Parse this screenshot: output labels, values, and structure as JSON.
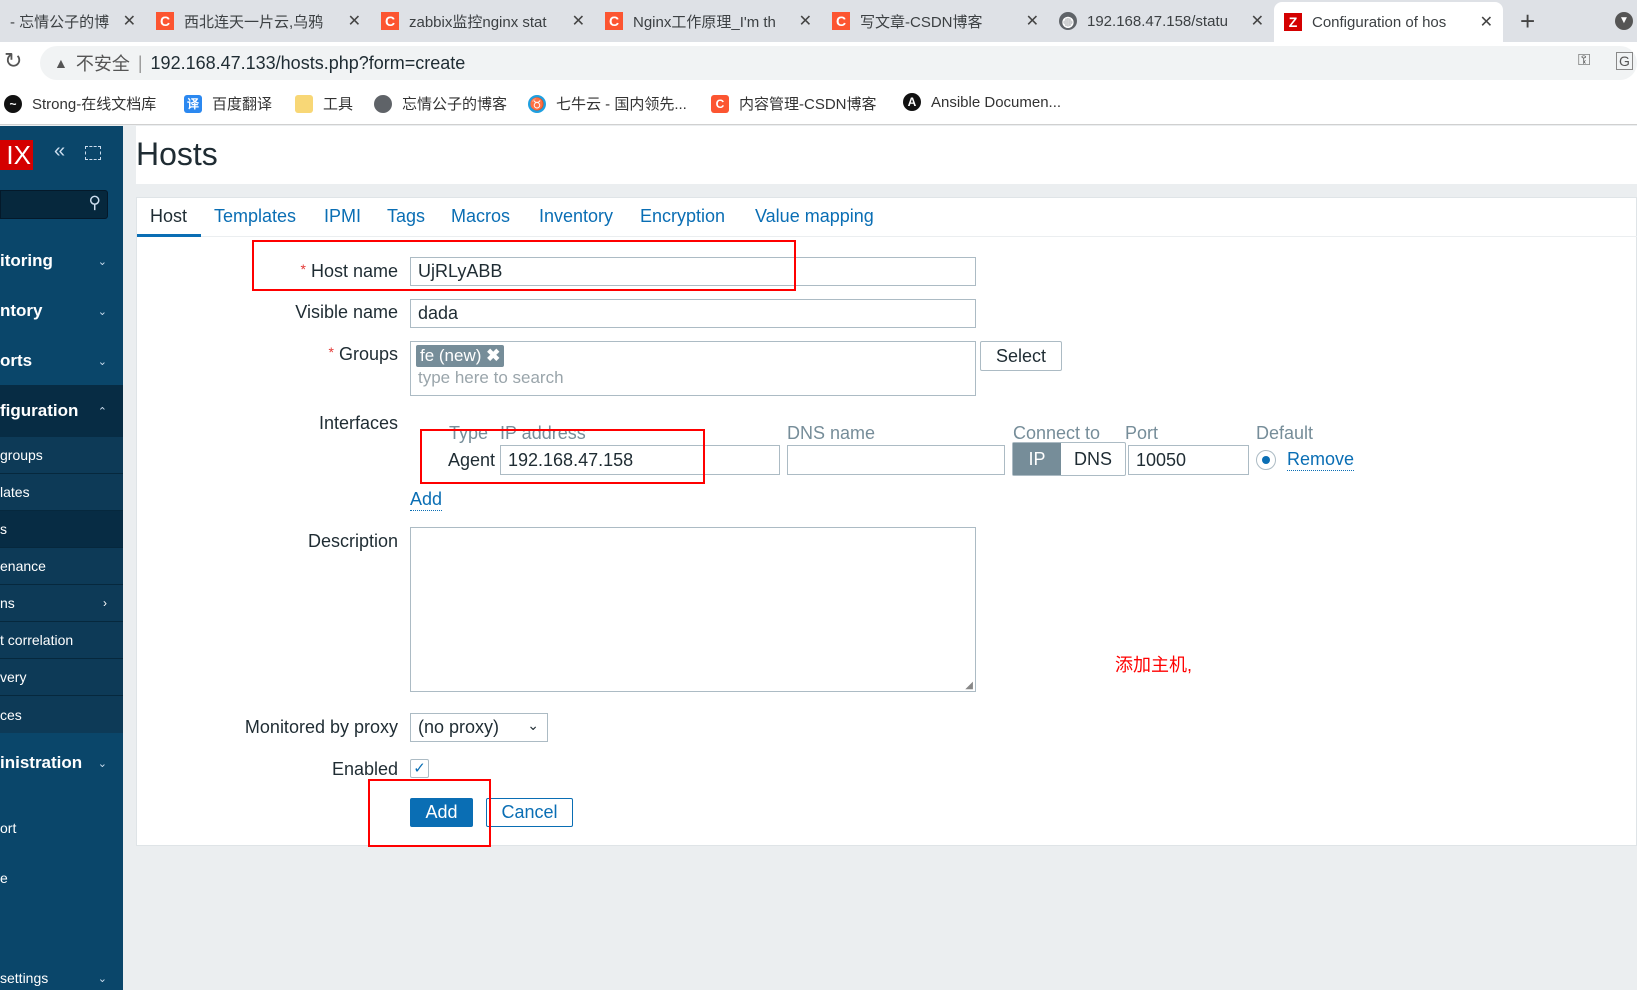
{
  "browser": {
    "tabs": [
      {
        "title": "- 忘情公子的博",
        "icon": "none"
      },
      {
        "title": "西北连天一片云,乌鸦",
        "icon": "csdn-icon"
      },
      {
        "title": "zabbix监控nginx stat",
        "icon": "csdn-icon"
      },
      {
        "title": "Nginx工作原理_I'm th",
        "icon": "csdn-icon"
      },
      {
        "title": "写文章-CSDN博客",
        "icon": "csdn-icon"
      },
      {
        "title": "192.168.47.158/statu",
        "icon": "globe-icon"
      },
      {
        "title": "Configuration of hos",
        "icon": "zabbix-icon",
        "active": true
      }
    ],
    "security_label": "不安全",
    "url": "192.168.47.133/hosts.php?form=create",
    "bookmarks": [
      {
        "label": "Strong-在线文档库",
        "icon": "bird-icon"
      },
      {
        "label": "百度翻译",
        "icon": "translate-icon"
      },
      {
        "label": "工具",
        "icon": "folder-icon"
      },
      {
        "label": "忘情公子的博客",
        "icon": "globe-icon"
      },
      {
        "label": "七牛云 - 国内领先...",
        "icon": "qiniu-icon"
      },
      {
        "label": "内容管理-CSDN博客",
        "icon": "csdn-icon"
      },
      {
        "label": "Ansible Documen...",
        "icon": "ansible-icon"
      }
    ]
  },
  "sidebar": {
    "logo": "IX",
    "menu": [
      {
        "label": "itoring"
      },
      {
        "label": "ntory"
      },
      {
        "label": "orts"
      },
      {
        "label": "figuration"
      },
      {
        "label": "inistration"
      }
    ],
    "submenu": [
      "groups",
      "lates",
      "s",
      "enance",
      "ns",
      "t correlation",
      "very",
      "ces"
    ],
    "bottom": [
      "ort",
      "e",
      "settings"
    ]
  },
  "page": {
    "title": "Hosts",
    "tabs": [
      "Host",
      "Templates",
      "IPMI",
      "Tags",
      "Macros",
      "Inventory",
      "Encryption",
      "Value mapping"
    ],
    "form": {
      "host_name_label": "Host name",
      "host_name": "UjRLyABB",
      "visible_name_label": "Visible name",
      "visible_name": "dada",
      "groups_label": "Groups",
      "group_tag": "fe (new)",
      "groups_placeholder": "type here to search",
      "select_label": "Select",
      "interfaces_label": "Interfaces",
      "iface_headers": {
        "type": "Type",
        "ip": "IP address",
        "dns": "DNS name",
        "connect": "Connect to",
        "port": "Port",
        "default": "Default"
      },
      "iface": {
        "type": "Agent",
        "ip": "192.168.47.158",
        "dns": "",
        "connect_options": [
          "IP",
          "DNS"
        ],
        "connect_selected": "IP",
        "port": "10050",
        "default": true,
        "remove": "Remove"
      },
      "add_iface": "Add",
      "description_label": "Description",
      "description": "",
      "proxy_label": "Monitored by proxy",
      "proxy": "(no proxy)",
      "enabled_label": "Enabled",
      "enabled": true,
      "add_button": "Add",
      "cancel_button": "Cancel"
    },
    "annotation": "添加主机,"
  },
  "colors": {
    "sidebar": "#0a466a",
    "accent": "#0a6eb4",
    "annotation": "#ff0000"
  }
}
